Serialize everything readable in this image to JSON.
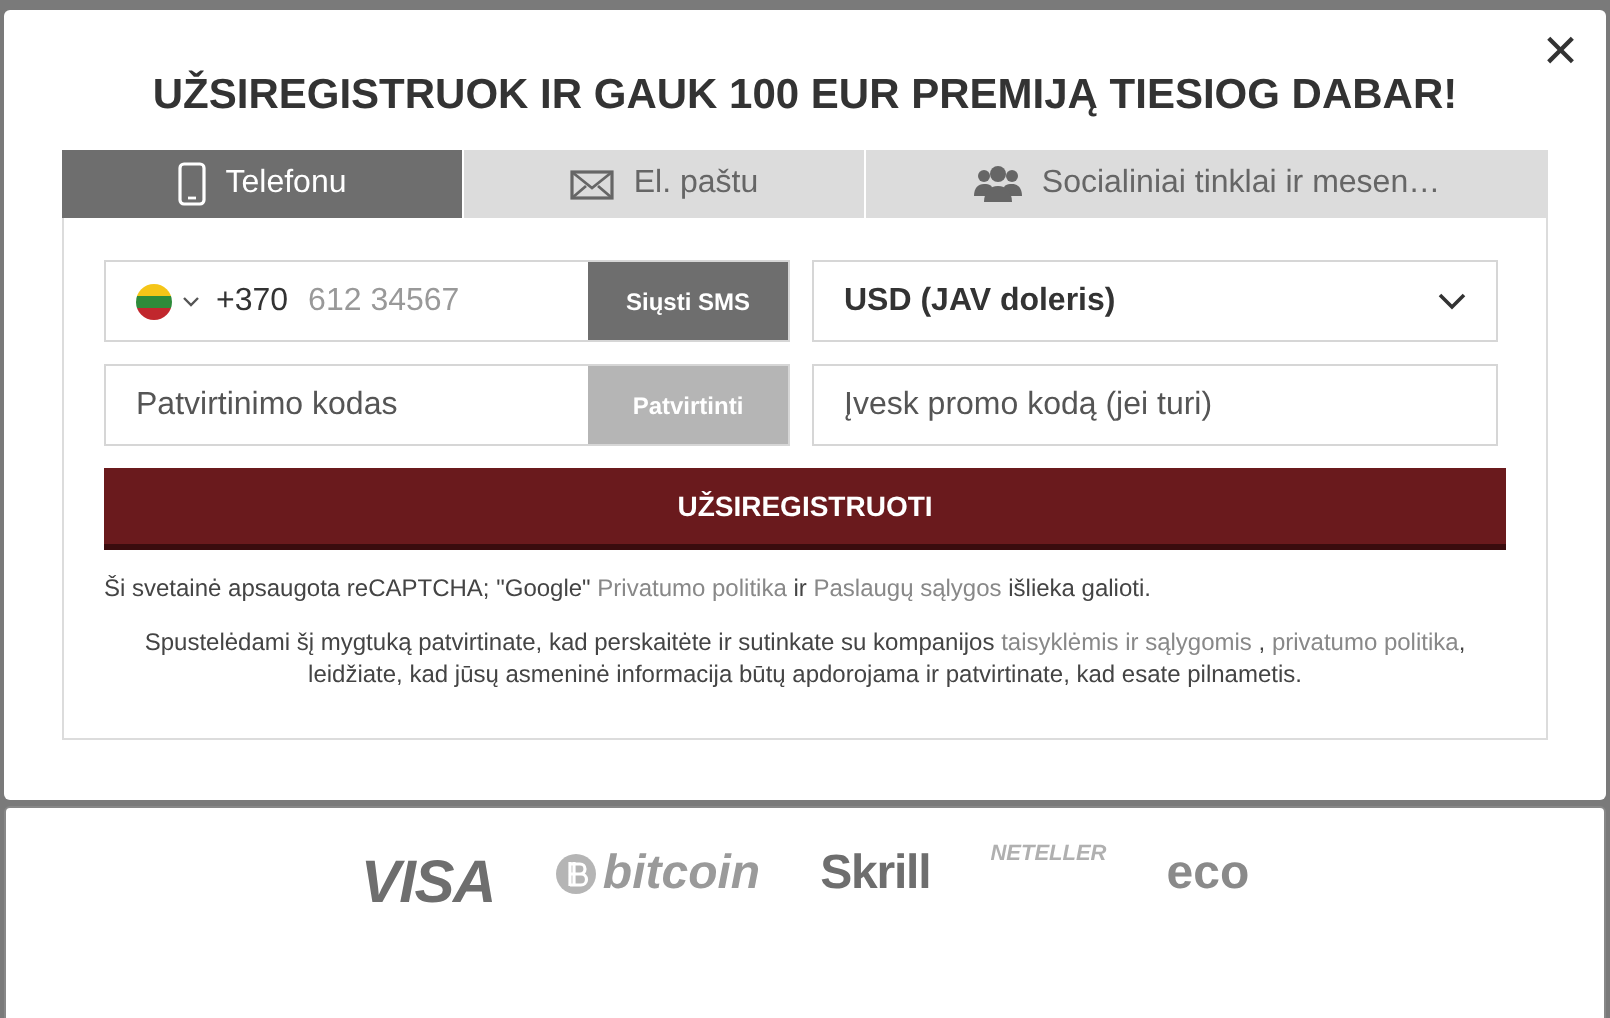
{
  "modal": {
    "title": "UŽSIREGISTRUOK IR GAUK 100 EUR PREMIJĄ TIESIOG DABAR!",
    "close": "×"
  },
  "tabs": [
    {
      "label": "Telefonu",
      "kind": "phone",
      "selected": true
    },
    {
      "label": "El. paštu",
      "kind": "email",
      "selected": false
    },
    {
      "label": "Socialiniai tinklai ir mesen…",
      "kind": "social",
      "selected": false
    }
  ],
  "phone": {
    "code": "+370",
    "placeholder": "612 34567",
    "button": "Siųsti SMS"
  },
  "currency": {
    "value": "USD (JAV doleris)"
  },
  "confirm": {
    "placeholder": "Patvirtinimo kodas",
    "button": "Patvirtinti",
    "disabled": true
  },
  "promo": {
    "placeholder": "Įvesk promo kodą (jei turi)"
  },
  "register_button": "UŽSIREGISTRUOTI",
  "recaptcha_note": [
    {
      "kind": "text",
      "text": "Ši svetainė apsaugota reCAPTCHA; \"Google\" "
    },
    {
      "kind": "link",
      "text": "Privatumo politika"
    },
    {
      "kind": "text",
      "text": " ir "
    },
    {
      "kind": "link",
      "text": "Paslaugų sąlygos"
    },
    {
      "kind": "text",
      "text": " išlieka galioti."
    }
  ],
  "consent_note": [
    {
      "kind": "text",
      "text": "Spustelėdami šį mygtuką patvirtinate, kad perskaitėte ir sutinkate su kompanijos "
    },
    {
      "kind": "link",
      "text": "taisyklėmis ir sąlygomis"
    },
    {
      "kind": "text",
      "text": " , "
    },
    {
      "kind": "link",
      "text": "privatumo politika"
    },
    {
      "kind": "text",
      "text": ", leidžiate, kad jūsų asmeninė informacija būtų apdorojama ir patvirtinate, kad esate pilnametis."
    }
  ],
  "payment_logos": [
    {
      "text": "VISA",
      "kind": "visa"
    },
    {
      "text": "bitcoin",
      "kind": "bitcoin"
    },
    {
      "text": "Skrill",
      "kind": "skrill"
    },
    {
      "text": "NETELLER",
      "kind": "neteller"
    },
    {
      "text": "eco",
      "kind": "eco"
    }
  ]
}
